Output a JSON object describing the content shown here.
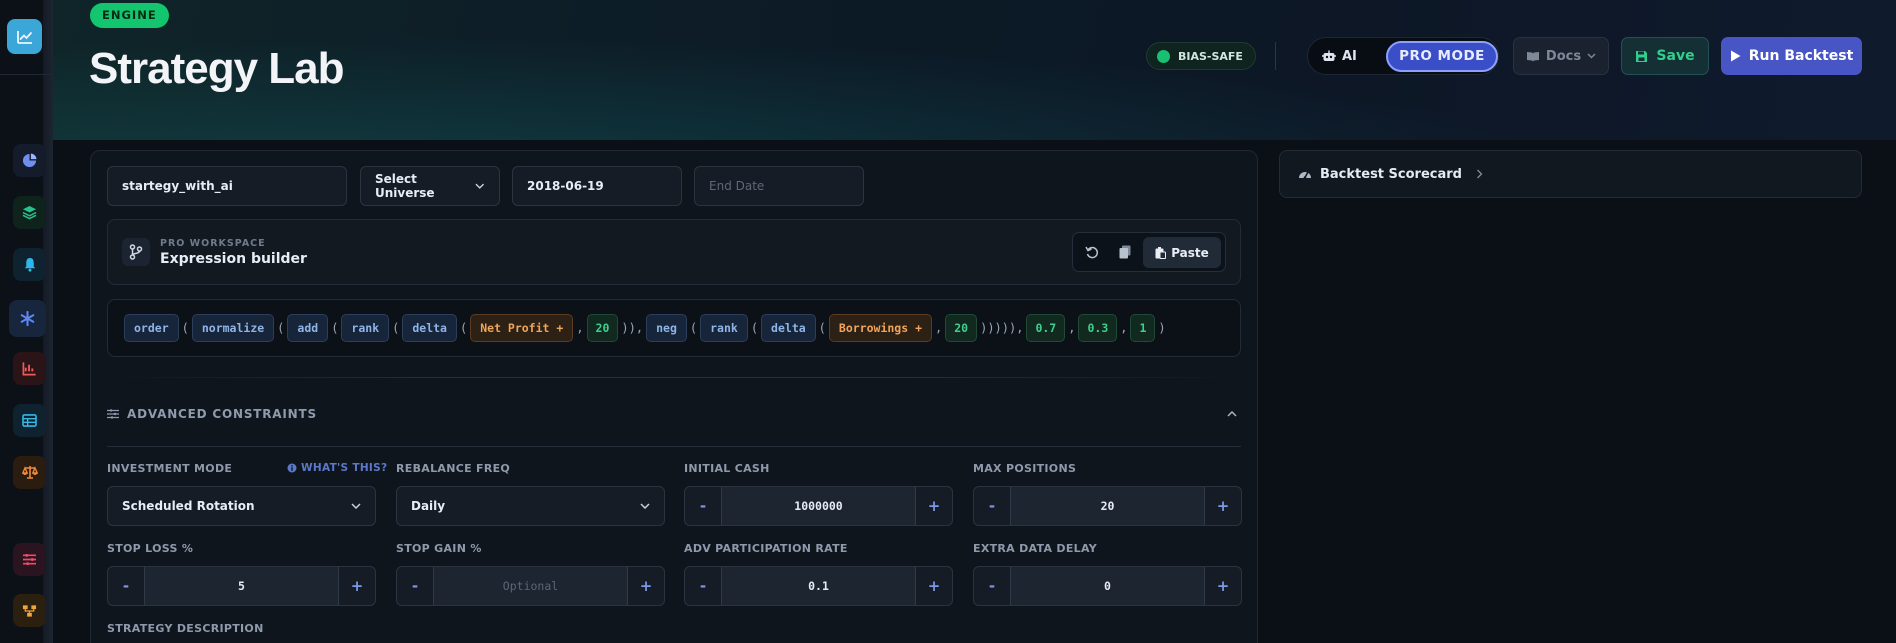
{
  "header": {
    "engine_badge": "ENGINE",
    "title": "Strategy Lab",
    "bias_badge": "BIAS-SAFE",
    "ai_label": "AI",
    "pro_mode_label": "PRO MODE",
    "docs_label": "Docs",
    "save_label": "Save",
    "run_label": "Run Backtest"
  },
  "sidebar": {
    "items": [
      {
        "icon": "pie-chart-icon",
        "color": "#6f8ff0"
      },
      {
        "icon": "layers-icon",
        "color": "#27c28a"
      },
      {
        "icon": "bell-icon",
        "color": "#2fb6e8"
      },
      {
        "icon": "asterisk-icon",
        "color": "#5e86f5",
        "active": true
      },
      {
        "icon": "line-chart-icon",
        "color": "#ef5a5a"
      },
      {
        "icon": "table-icon",
        "color": "#36b7e6"
      },
      {
        "icon": "scale-icon",
        "color": "#f08a3a"
      },
      {
        "icon": "sliders-icon",
        "color": "#ef4a6a"
      },
      {
        "icon": "hierarchy-icon",
        "color": "#f4a53a"
      }
    ]
  },
  "form": {
    "strategy_name": "startegy_with_ai",
    "universe_label": "Select Universe",
    "start_date": "2018-06-19",
    "end_date_placeholder": "End Date"
  },
  "workspace": {
    "kicker": "PRO WORKSPACE",
    "title": "Expression builder",
    "paste_label": "Paste"
  },
  "expression": {
    "tokens": [
      "order",
      "(",
      "normalize",
      "(",
      "add",
      "(",
      "rank",
      "(",
      "delta",
      "(",
      "Net Profit +",
      ",",
      "20",
      ")),",
      "neg",
      "(",
      "rank",
      "(",
      "delta",
      "(",
      "Borrowings +",
      ",",
      "20",
      "))))),",
      "0.7",
      ",",
      "0.3",
      ",",
      "1",
      ")"
    ]
  },
  "constraints": {
    "section_title": "ADVANCED CONSTRAINTS",
    "investment_mode_label": "INVESTMENT MODE",
    "whats_this": "WHAT'S THIS?",
    "investment_mode_value": "Scheduled Rotation",
    "rebalance_label": "REBALANCE FREQ",
    "rebalance_value": "Daily",
    "initial_cash_label": "INITIAL CASH",
    "initial_cash_value": "1000000",
    "max_positions_label": "MAX POSITIONS",
    "max_positions_value": "20",
    "stop_loss_label": "STOP LOSS %",
    "stop_loss_value": "5",
    "stop_gain_label": "STOP GAIN %",
    "stop_gain_placeholder": "Optional",
    "adv_rate_label": "ADV PARTICIPATION RATE",
    "adv_rate_value": "0.1",
    "data_delay_label": "EXTRA DATA DELAY",
    "data_delay_value": "0",
    "description_label": "STRATEGY DESCRIPTION",
    "minus": "-",
    "plus": "+"
  },
  "scorecard": {
    "title": "Backtest Scorecard"
  }
}
